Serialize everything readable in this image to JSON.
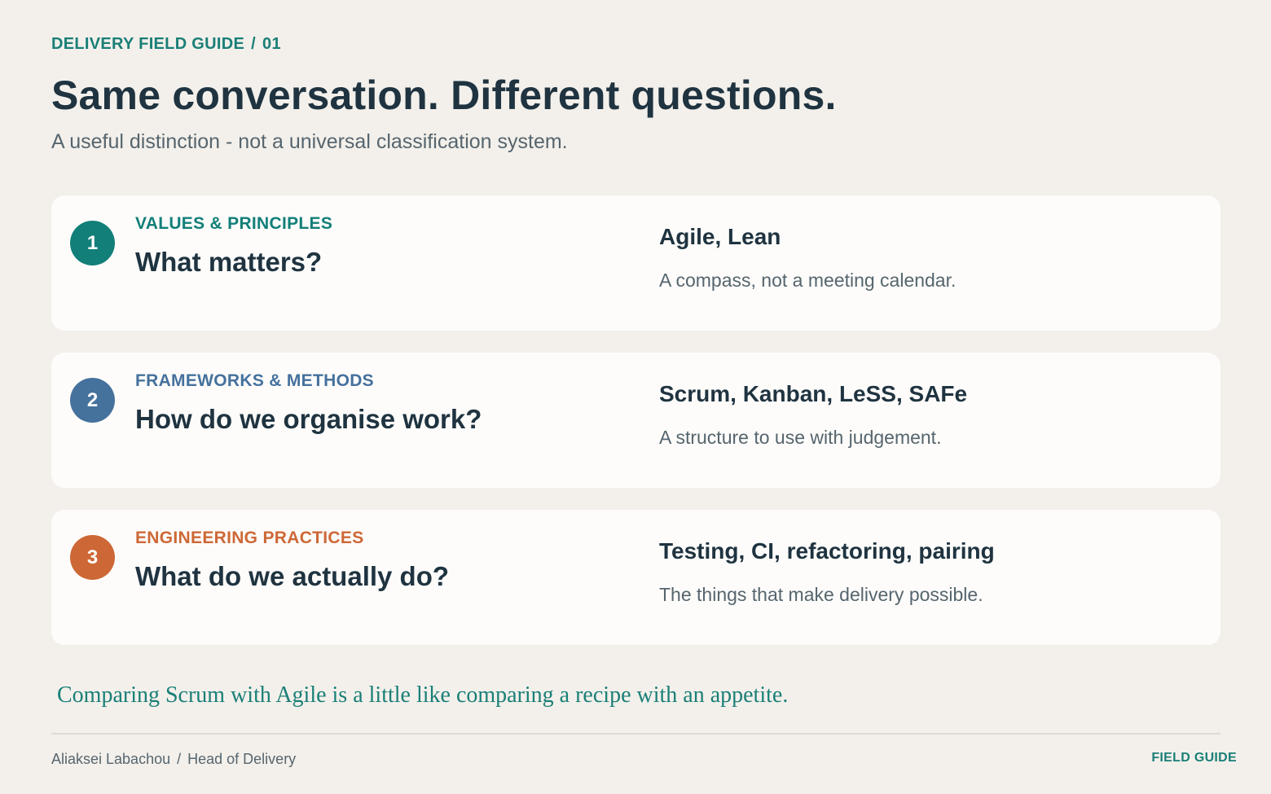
{
  "header": {
    "eyebrow_title": "DELIVERY FIELD GUIDE",
    "eyebrow_separator": "/",
    "eyebrow_number": "01",
    "title": "Same conversation. Different questions.",
    "subtitle": "A useful distinction - not a universal classification system."
  },
  "cards": [
    {
      "number": "1",
      "category": "VALUES & PRINCIPLES",
      "question": "What matters?",
      "examples": "Agile, Lean",
      "note": "A compass, not a meeting calendar.",
      "color": "#127f78"
    },
    {
      "number": "2",
      "category": "FRAMEWORKS & METHODS",
      "question": "How do we organise work?",
      "examples": "Scrum, Kanban, LeSS, SAFe",
      "note": "A structure to use with judgement.",
      "color": "#45719d"
    },
    {
      "number": "3",
      "category": "ENGINEERING PRACTICES",
      "question": "What do we actually do?",
      "examples": "Testing, CI, refactoring, pairing",
      "note": "The things that make delivery possible.",
      "color": "#cd6836"
    }
  ],
  "quote": "Comparing Scrum with Agile is a little like comparing a recipe with an appetite.",
  "footer": {
    "author": "Aliaksei Labachou",
    "separator": "/",
    "role": "Head of Delivery",
    "brand": "FIELD GUIDE"
  }
}
